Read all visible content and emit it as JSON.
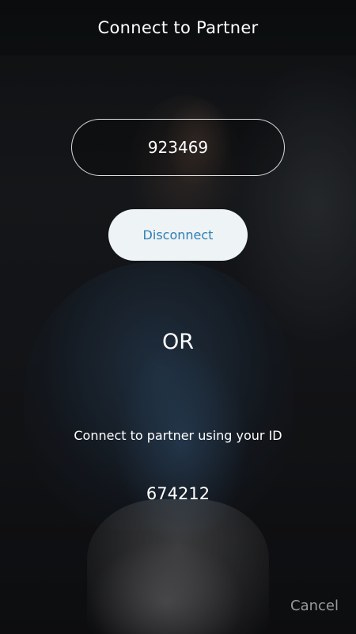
{
  "header": {
    "title": "Connect to Partner"
  },
  "partner_input": {
    "value": "923469"
  },
  "actions": {
    "disconnect_label": "Disconnect",
    "cancel_label": "Cancel"
  },
  "divider": {
    "label": "OR"
  },
  "own_id": {
    "instructions": "Connect to partner using your ID",
    "value": "674212"
  },
  "colors": {
    "button_background": "#eef3f6",
    "button_text": "#2f7fb3",
    "text": "#ffffff",
    "cancel_text": "#c8c8c8"
  }
}
